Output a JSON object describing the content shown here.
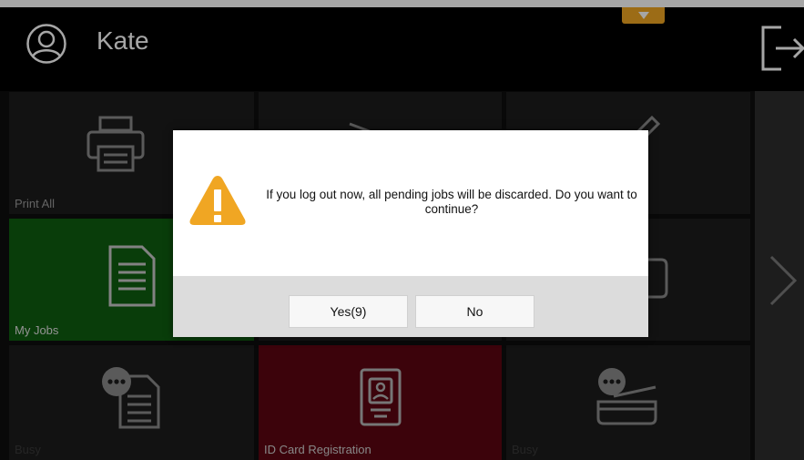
{
  "header": {
    "user_name": "Kate",
    "user_icon": "user-circle-icon",
    "logout_icon": "logout-icon",
    "pull_tab_icon": "chevron-down-icon"
  },
  "tiles": [
    {
      "label": "Print All",
      "icon": "printer-icon",
      "state": "normal"
    },
    {
      "label": "",
      "icon": "scan-icon",
      "state": "normal"
    },
    {
      "label": "",
      "icon": "pencil-icon",
      "state": "normal"
    },
    {
      "label": "My Jobs",
      "icon": "document-icon",
      "state": "active"
    },
    {
      "label": "",
      "icon": "",
      "state": "normal"
    },
    {
      "label": "",
      "icon": "clipboard-icon",
      "state": "normal"
    },
    {
      "label": "Busy",
      "icon": "documents-busy-icon",
      "state": "normal"
    },
    {
      "label": "ID Card Registration",
      "icon": "id-card-icon",
      "state": "highlight"
    },
    {
      "label": "Busy",
      "icon": "scanner-busy-icon",
      "state": "normal"
    }
  ],
  "nav": {
    "next_icon": "chevron-right-icon"
  },
  "dialog": {
    "icon": "warning-icon",
    "message": "If you log out now, all pending jobs will be discarded. Do you want to continue?",
    "yes_label": "Yes(9)",
    "no_label": "No"
  },
  "colors": {
    "accent": "#f0a623",
    "active_tile": "#0f5f10",
    "highlight_tile": "#5d0612",
    "tile": "#1c1c1c"
  }
}
